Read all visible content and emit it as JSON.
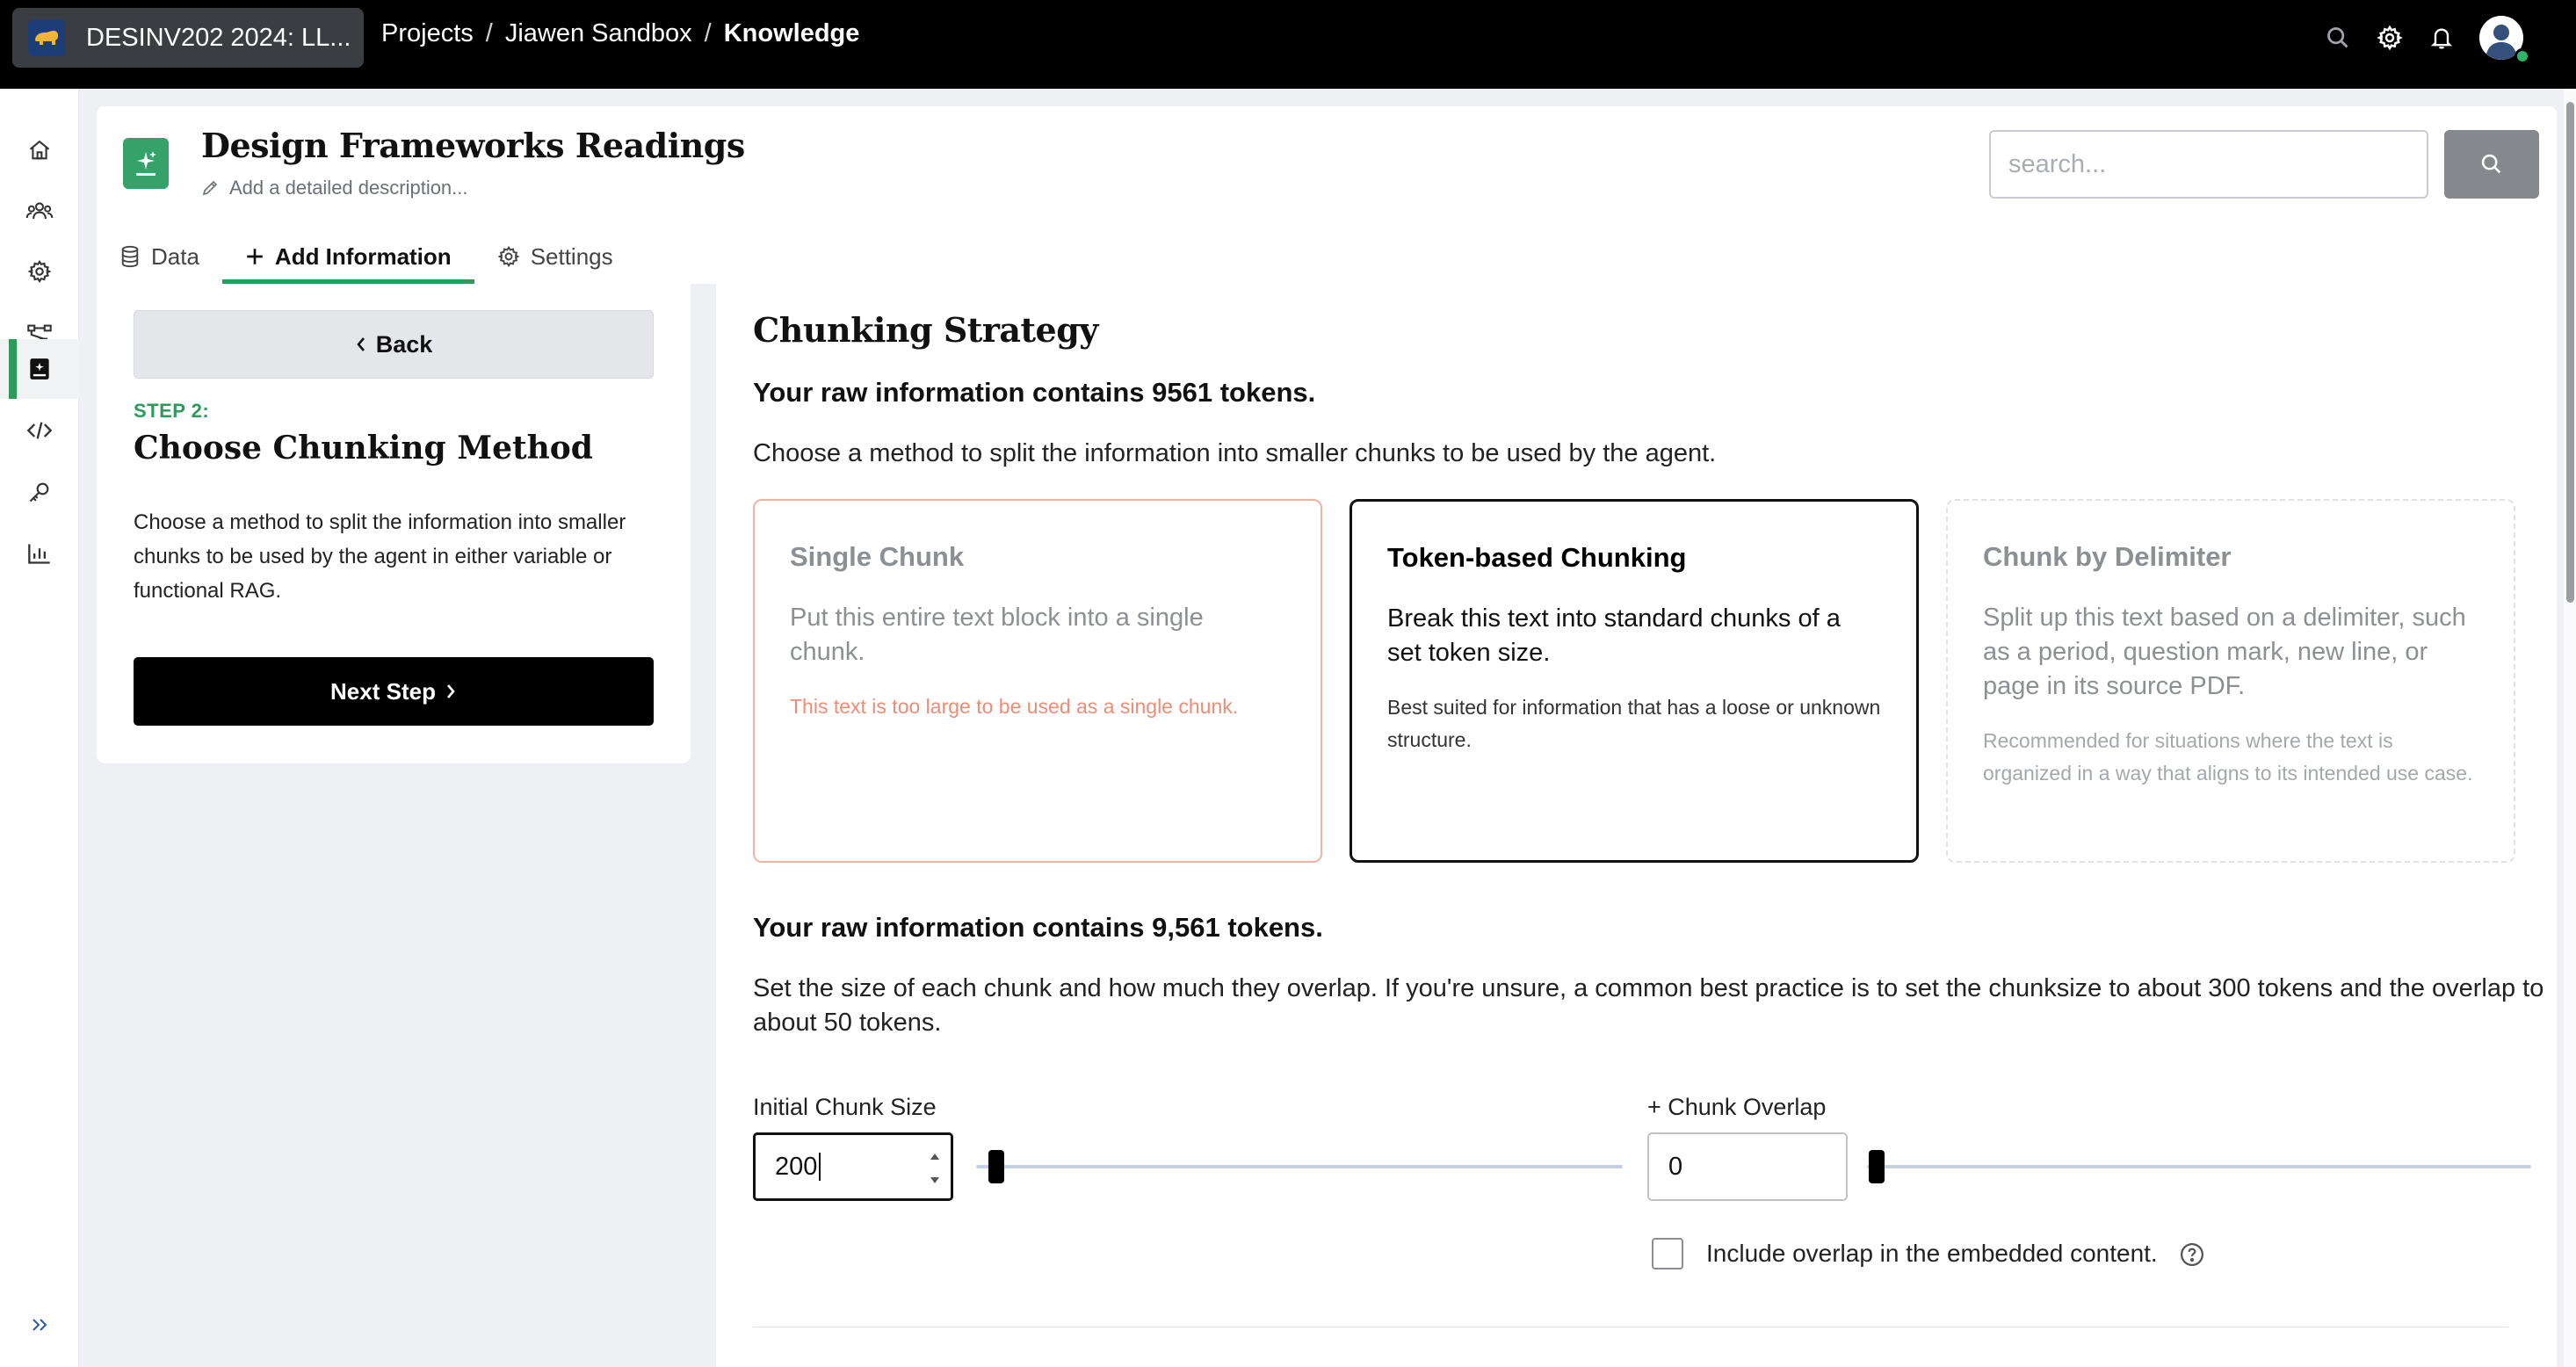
{
  "topbar": {
    "course_title": "DESINV202 2024: LL...",
    "breadcrumbs": [
      "Projects",
      "Jiawen Sandbox",
      "Knowledge"
    ],
    "separator": "/"
  },
  "rail": {
    "items": [
      "home-icon",
      "users-icon",
      "gear-icon",
      "flow-icon",
      "knowledge-icon",
      "code-icon",
      "key-icon",
      "chart-icon"
    ],
    "active": "knowledge-icon",
    "expand": "expand-icon"
  },
  "header": {
    "title": "Design Frameworks Readings",
    "description_placeholder": "Add a detailed description...",
    "search_placeholder": "search...",
    "tabs": [
      {
        "label": "Data",
        "icon": "database-icon"
      },
      {
        "label": "Add Information",
        "icon": "plus-icon"
      },
      {
        "label": "Settings",
        "icon": "gear-icon"
      }
    ],
    "active_tab": "Add Information"
  },
  "step": {
    "back_label": "Back",
    "step_label": "STEP 2:",
    "title": "Choose Chunking Method",
    "description": "Choose a method to split the information into smaller chunks to be used by the agent in either variable or functional RAG.",
    "next_label": "Next Step"
  },
  "main": {
    "title": "Chunking Strategy",
    "tokens_line": "Your raw information contains 9561 tokens.",
    "intro": "Choose a method to split the information into smaller chunks to be used by the agent.",
    "options": [
      {
        "title": "Single Chunk",
        "description": "Put this entire text block into a single chunk.",
        "note": "This text is too large to be used as a single chunk.",
        "state": "disabled"
      },
      {
        "title": "Token-based Chunking",
        "description": "Break this text into standard chunks of a set token size.",
        "note": "Best suited for information that has a loose or unknown structure.",
        "state": "selected"
      },
      {
        "title": "Chunk by Delimiter",
        "description": "Split up this text based on a delimiter, such as a period, question mark, new line, or page in its source PDF.",
        "note": "Recommended for situations where the text is organized in a way that aligns to its intended use case.",
        "state": "inactive"
      }
    ],
    "tokens_line2": "Your raw information contains 9,561 tokens.",
    "size_description": "Set the size of each chunk and how much they overlap. If you're unsure, a common best practice is to set the chunksize to about 300 tokens and the overlap to about 50 tokens.",
    "chunk_size": {
      "label": "Initial Chunk Size",
      "value": "200",
      "slider_fraction": 0.0
    },
    "chunk_overlap": {
      "label": "+ Chunk Overlap",
      "value": "0",
      "slider_fraction": 0.0
    },
    "include_overlap": {
      "label": "Include overlap in the embedded content.",
      "checked": false
    }
  },
  "colors": {
    "accent_green": "#2e9a5d",
    "error_text": "#ec8e77",
    "topbar": "#000000"
  }
}
